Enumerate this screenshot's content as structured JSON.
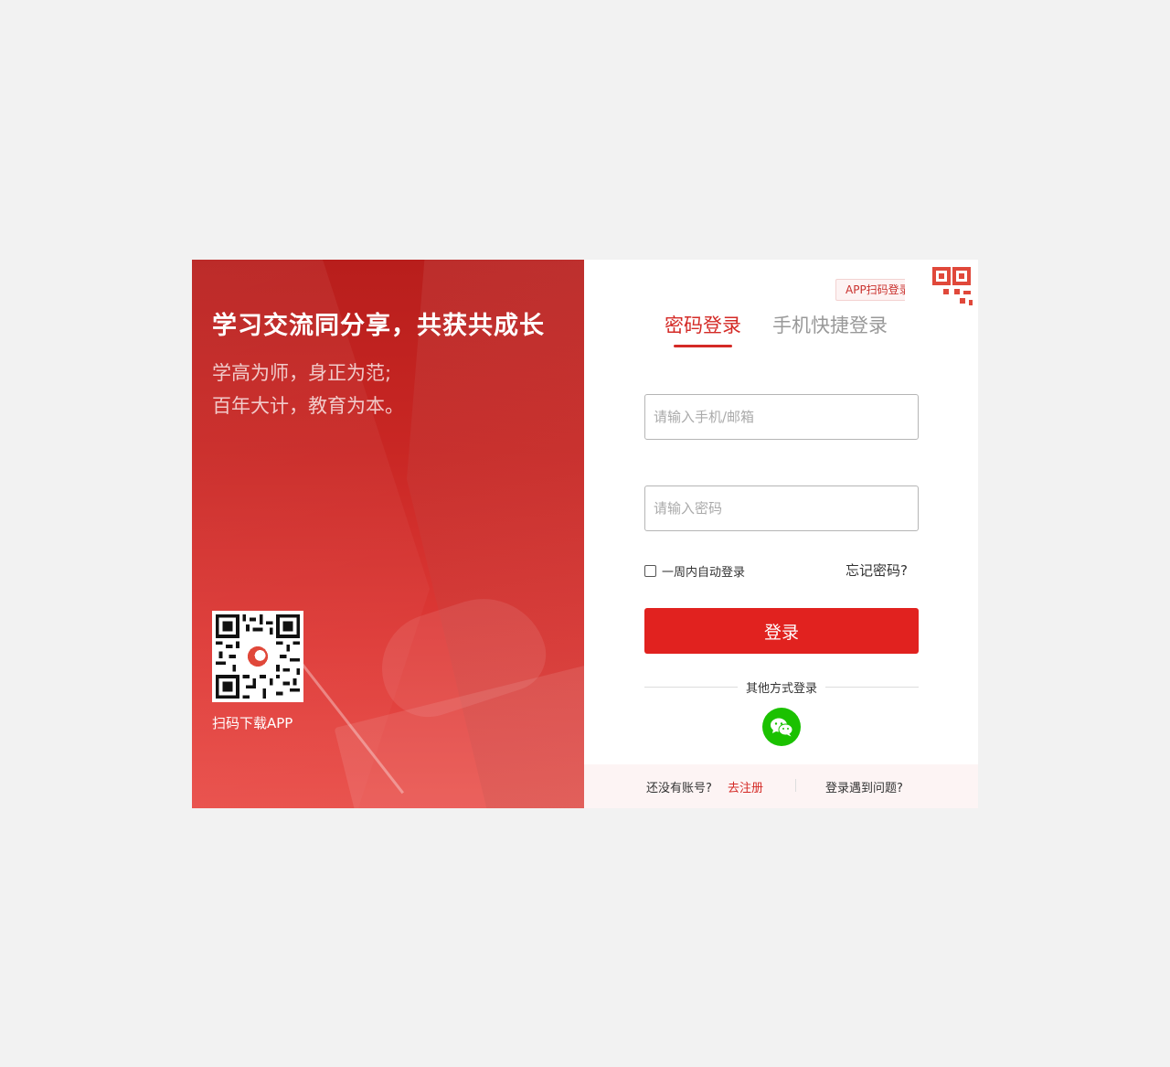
{
  "left_panel": {
    "slogan": "学习交流同分享，共获共成长",
    "subtitle_line1": "学高为师，身正为范;",
    "subtitle_line2": "百年大计，教育为本。",
    "qr_caption": "扫码下载APP"
  },
  "right_panel": {
    "app_scan_label": "APP扫码登录",
    "tabs": [
      {
        "label": "密码登录",
        "active": true
      },
      {
        "label": "手机快捷登录",
        "active": false
      }
    ],
    "account_input": {
      "placeholder": "请输入手机/邮箱",
      "value": ""
    },
    "password_input": {
      "placeholder": "请输入密码",
      "value": ""
    },
    "remember_label": "一周内自动登录",
    "forgot_label": "忘记密码?",
    "login_label": "登录",
    "other_login_label": "其他方式登录",
    "other_login_icon": "wechat-icon"
  },
  "footer": {
    "no_account": "还没有账号?",
    "register": "去注册",
    "problem": "登录遇到问题?"
  },
  "colors": {
    "accent": "#d42a26",
    "button": "#e1221f",
    "wechat": "#1bc100",
    "page_bg": "#f2f2f2"
  }
}
